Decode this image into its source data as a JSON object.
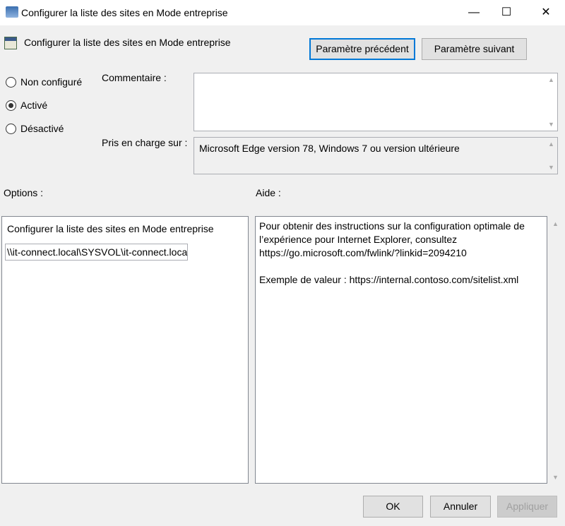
{
  "window": {
    "title": "Configurer la liste des sites en Mode entreprise",
    "minimize": "—",
    "maximize": "☐",
    "close": "✕"
  },
  "header": {
    "policy_name": "Configurer la liste des sites en Mode entreprise",
    "prev_button": "Paramètre précédent",
    "next_button": "Paramètre suivant"
  },
  "state": {
    "options": [
      {
        "label": "Non configuré",
        "selected": false
      },
      {
        "label": "Activé",
        "selected": true
      },
      {
        "label": "Désactivé",
        "selected": false
      }
    ]
  },
  "comment": {
    "label": "Commentaire :",
    "value": ""
  },
  "supported": {
    "label": "Pris en charge sur :",
    "value": "Microsoft Edge version 78, Windows 7 ou version ultérieure"
  },
  "options_section": {
    "label": "Options :",
    "field_label": "Configurer la liste des sites en Mode entreprise",
    "field_value": "\\\\it-connect.local\\SYSVOL\\it-connect.local\\"
  },
  "help_section": {
    "label": "Aide :",
    "lines": [
      "Pour obtenir des instructions sur la configuration optimale de",
      "l’expérience pour Internet Explorer, consultez",
      "https://go.microsoft.com/fwlink/?linkid=2094210",
      "",
      "Exemple de valeur : https://internal.contoso.com/sitelist.xml"
    ]
  },
  "footer": {
    "ok": "OK",
    "cancel": "Annuler",
    "apply": "Appliquer"
  }
}
